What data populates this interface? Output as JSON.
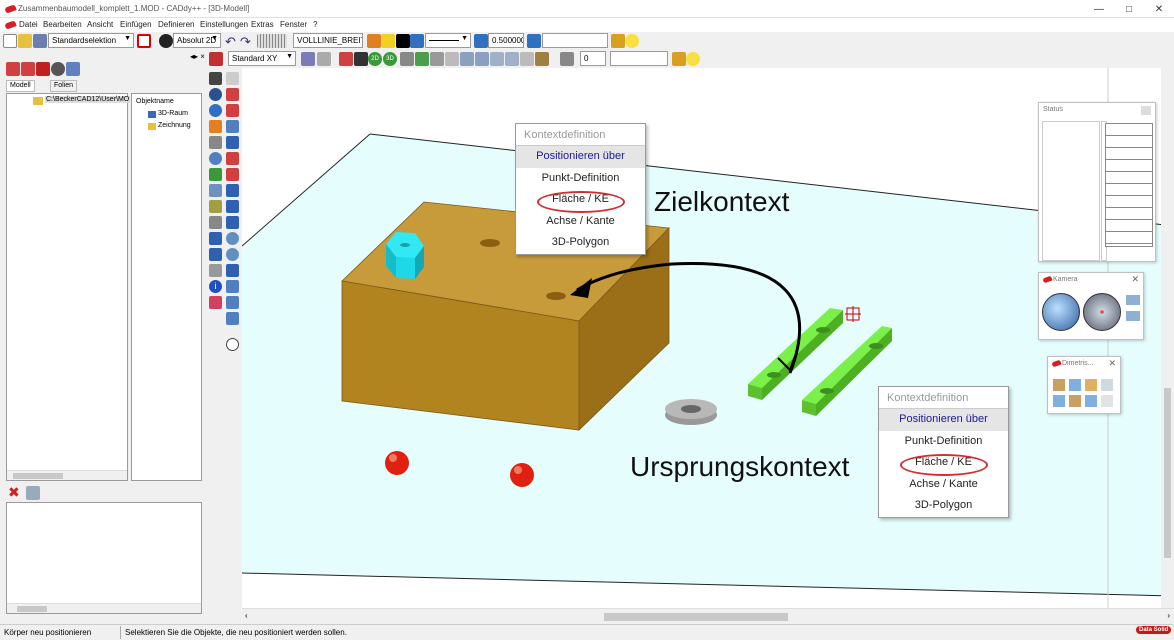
{
  "window": {
    "title": "Zusammenbaumodell_komplett_1.MOD - CADdy++ - [3D-Modell]"
  },
  "menu": [
    "Datei",
    "Bearbeiten",
    "Ansicht",
    "Einfügen",
    "Definieren",
    "Einstellungen",
    "Extras",
    "Fenster",
    "?"
  ],
  "toolbar": {
    "selection_mode": "Standardselektion",
    "coord_mode": "Absolut 2D",
    "linetype": "VOLLLINIE_BREIT",
    "linewidth": "0.500000",
    "plane": "Standard XY",
    "layer_value": "0"
  },
  "left_panel": {
    "tabs": [
      "Modell",
      "Folien"
    ],
    "path": "C:\\BeckerCAD12\\User\\MO",
    "column_header": "Objektname",
    "objects": [
      "3D-Raum",
      "Zeichnung"
    ]
  },
  "context_menu_target": {
    "title": "Kontextdefinition",
    "items": [
      "Positionieren über",
      "Punkt-Definition",
      "Fläche / KE",
      "Achse / Kante",
      "3D-Polygon"
    ],
    "selected": "Positionieren über",
    "highlighted": "Fläche / KE"
  },
  "context_menu_source": {
    "title": "Kontextdefinition",
    "items": [
      "Positionieren über",
      "Punkt-Definition",
      "Fläche / KE",
      "Achse / Kante",
      "3D-Polygon"
    ],
    "selected": "Positionieren über",
    "highlighted": "Fläche / KE"
  },
  "annotations": {
    "target": "Zielkontext",
    "source": "Ursprungskontext"
  },
  "side_windows": {
    "status": "Status",
    "camera": "Kamera",
    "dimetric": "Dimetris..."
  },
  "statusbar": {
    "left": "Körper neu positionieren",
    "right": "Selektieren Sie die Objekte, die neu positioniert werden sollen."
  },
  "brand": "Data Solid",
  "colors": {
    "floor": "#e5fdfd",
    "block": "#c79a3a",
    "nut": "#1ed8e8",
    "plates": "#6ee03c",
    "spheres": "#e02010",
    "ring": "#d23030"
  }
}
